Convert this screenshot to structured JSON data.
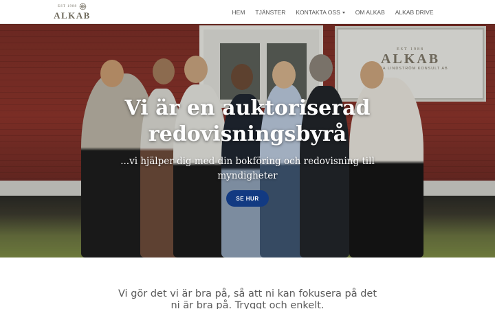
{
  "brand": {
    "est": "EST 1988",
    "name": "ALKAB"
  },
  "nav": {
    "items": [
      {
        "label": "HEM"
      },
      {
        "label": "TJÄNSTER"
      },
      {
        "label": "KONTAKTA OSS",
        "has_dropdown": true
      },
      {
        "label": "OM ALKAB"
      },
      {
        "label": "ALKAB DRIVE"
      }
    ]
  },
  "sign": {
    "est": "EST 1988",
    "name": "ALKAB",
    "sub": "ANNA LINDSTRÖM KONSULT AB"
  },
  "hero": {
    "title": "Vi är en auktoriserad\nredovisningsbyrå",
    "subtitle": "...vi hjälper dig med din bokföring och redovisning till myndigheter",
    "cta_label": "SE HUR",
    "cta_color": "#123a82"
  },
  "section": {
    "tagline": "Vi gör det vi är bra på, så att ni kan fokusera på det ni är bra på. Tryggt och enkelt."
  }
}
